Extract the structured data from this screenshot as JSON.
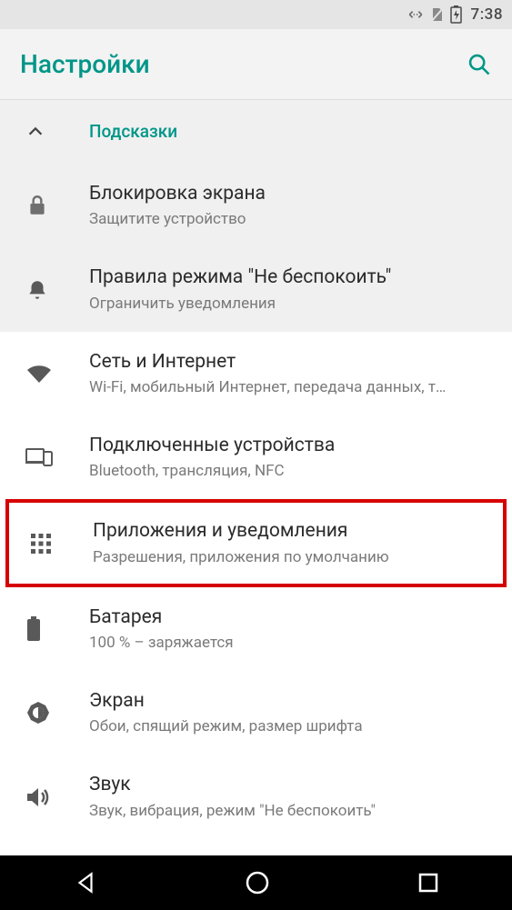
{
  "status": {
    "time": "7:38"
  },
  "appbar": {
    "title": "Настройки"
  },
  "tips": {
    "header": "Подсказки",
    "items": [
      {
        "title": "Блокировка экрана",
        "subtitle": "Защитите устройство"
      },
      {
        "title": "Правила режима \"Не беспокоить\"",
        "subtitle": "Ограничить уведомления"
      }
    ]
  },
  "settings": [
    {
      "title": "Сеть и Интернет",
      "subtitle": "Wi-Fi, мобильный Интернет, передача данных, т…"
    },
    {
      "title": "Подключенные устройства",
      "subtitle": "Bluetooth, трансляция, NFC"
    },
    {
      "title": "Приложения и уведомления",
      "subtitle": "Разрешения, приложения по умолчанию",
      "highlighted": true
    },
    {
      "title": "Батарея",
      "subtitle": "100 % – заряжается"
    },
    {
      "title": "Экран",
      "subtitle": "Обои, спящий режим, размер шрифта"
    },
    {
      "title": "Звук",
      "subtitle": "Звук, вибрация, режим \"Не беспокоить\""
    }
  ]
}
